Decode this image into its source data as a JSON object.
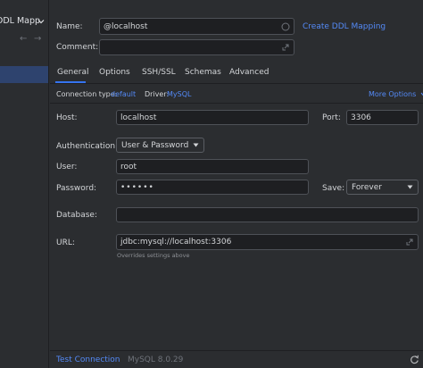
{
  "sidebar": {
    "header_label": "DDL Mapp",
    "back_glyph": "←",
    "forward_glyph": "→"
  },
  "form": {
    "name_label": "Name:",
    "name_value": "@localhost",
    "create_ddl_link": "Create DDL Mapping",
    "comment_label": "Comment:",
    "comment_value": ""
  },
  "tabs": [
    {
      "label": "General"
    },
    {
      "label": "Options"
    },
    {
      "label": "SSH/SSL"
    },
    {
      "label": "Schemas"
    },
    {
      "label": "Advanced"
    }
  ],
  "connection": {
    "type_label": "Connection type:",
    "type_value": "default",
    "driver_label": "Driver:",
    "driver_value": "MySQL",
    "more_options": "More Options"
  },
  "general": {
    "host_label": "Host:",
    "host_value": "localhost",
    "port_label": "Port:",
    "port_value": "3306",
    "auth_label": "Authentication:",
    "auth_value": "User & Password",
    "user_label": "User:",
    "user_value": "root",
    "password_label": "Password:",
    "password_value": "••••••",
    "save_label": "Save:",
    "save_value": "Forever",
    "database_label": "Database:",
    "database_value": "",
    "url_label": "URL:",
    "url_value": "jdbc:mysql://localhost:3306",
    "url_hint": "Overrides settings above"
  },
  "footer": {
    "test_connection": "Test Connection",
    "driver_version": "MySQL 8.0.29"
  },
  "colors": {
    "accent": "#548af7",
    "background": "#2b2d30",
    "field_bg": "#1e1f22",
    "selection": "#2e436e"
  },
  "icons": [
    "chevron-down-icon",
    "back-arrow-icon",
    "forward-arrow-icon",
    "circle-icon",
    "expand-icon",
    "chevron-right-icon",
    "refresh-icon"
  ]
}
